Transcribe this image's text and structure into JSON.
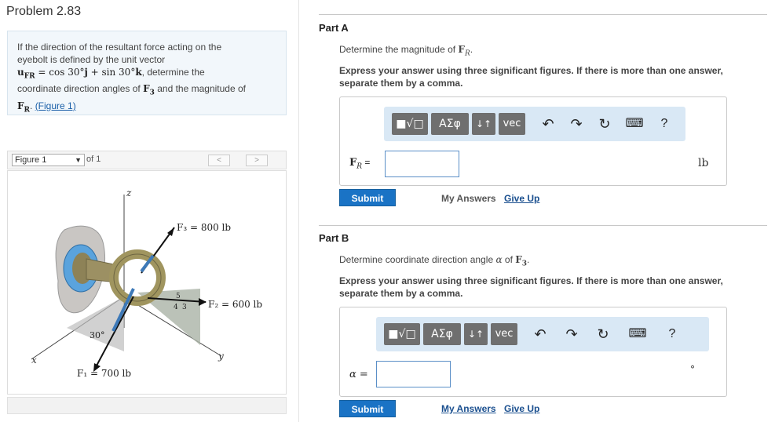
{
  "left": {
    "title": "Problem 2.83",
    "statement": {
      "line1": "If the direction of the resultant force acting on the",
      "line2": "eyebolt is defined by the unit vector",
      "unit_vec": "u",
      "unit_sub": "FR",
      "eq": " = cos 30°",
      "j": "j",
      "plus": " + sin 30°",
      "k": "k",
      "line3_tail": ", determine the",
      "line4a": "coordinate direction angles of ",
      "F3": "F",
      "F3sub": "3",
      "line4b": " and the magnitude of",
      "FR": "F",
      "FRsub": "R",
      "period": ". ",
      "fig_link": "(Figure 1)"
    },
    "figure_bar": {
      "selected": "Figure 1",
      "of_text": "of 1",
      "prev": "<",
      "next": ">"
    },
    "figure": {
      "z_label": "z",
      "x_label": "x",
      "y_label": "y",
      "f3_label": "F₃ = 800 lb",
      "f2_label": "F₂ = 600 lb",
      "f1_label": "F₁ = 700 lb",
      "angle_label": "30°",
      "tri_5": "5",
      "tri_4": "4",
      "tri_3": "3"
    }
  },
  "partA": {
    "label": "Part A",
    "question_pre": "Determine the magnitude of ",
    "question_var": "F",
    "question_sub": "R",
    "question_post": ".",
    "instructions": "Express your answer using three significant figures. If there is more than one answer, separate them by a comma.",
    "toolbar": {
      "templates": "■√□",
      "greek": "ΑΣφ",
      "arrows": "↓↑",
      "vec": "vec",
      "undo": "↶",
      "redo": "↷",
      "reset": "↻",
      "keyboard": "⌨",
      "help": "?"
    },
    "var_label": "F",
    "var_sub": "R",
    "var_eq": " =",
    "input_value": "",
    "unit": "lb",
    "submit": "Submit",
    "my_answers": "My Answers",
    "give_up": "Give Up"
  },
  "partB": {
    "label": "Part B",
    "question_pre": "Determine coordinate direction angle ",
    "question_var": "α",
    "question_mid": " of ",
    "question_F": "F",
    "question_sub": "3",
    "question_post": ".",
    "instructions": "Express your answer using three significant figures. If there is more than one answer, separate them by a comma.",
    "toolbar": {
      "templates": "■√□",
      "greek": "ΑΣφ",
      "arrows": "↓↑",
      "vec": "vec",
      "undo": "↶",
      "redo": "↷",
      "reset": "↻",
      "keyboard": "⌨",
      "help": "?"
    },
    "var_label": "α =",
    "input_value": "",
    "unit": "°",
    "submit": "Submit",
    "my_answers": "My Answers",
    "give_up": "Give Up"
  },
  "colors": {
    "accent": "#1a73c5",
    "toolbar_bg": "#d9e8f5",
    "statement_bg": "#f2f7fb"
  }
}
